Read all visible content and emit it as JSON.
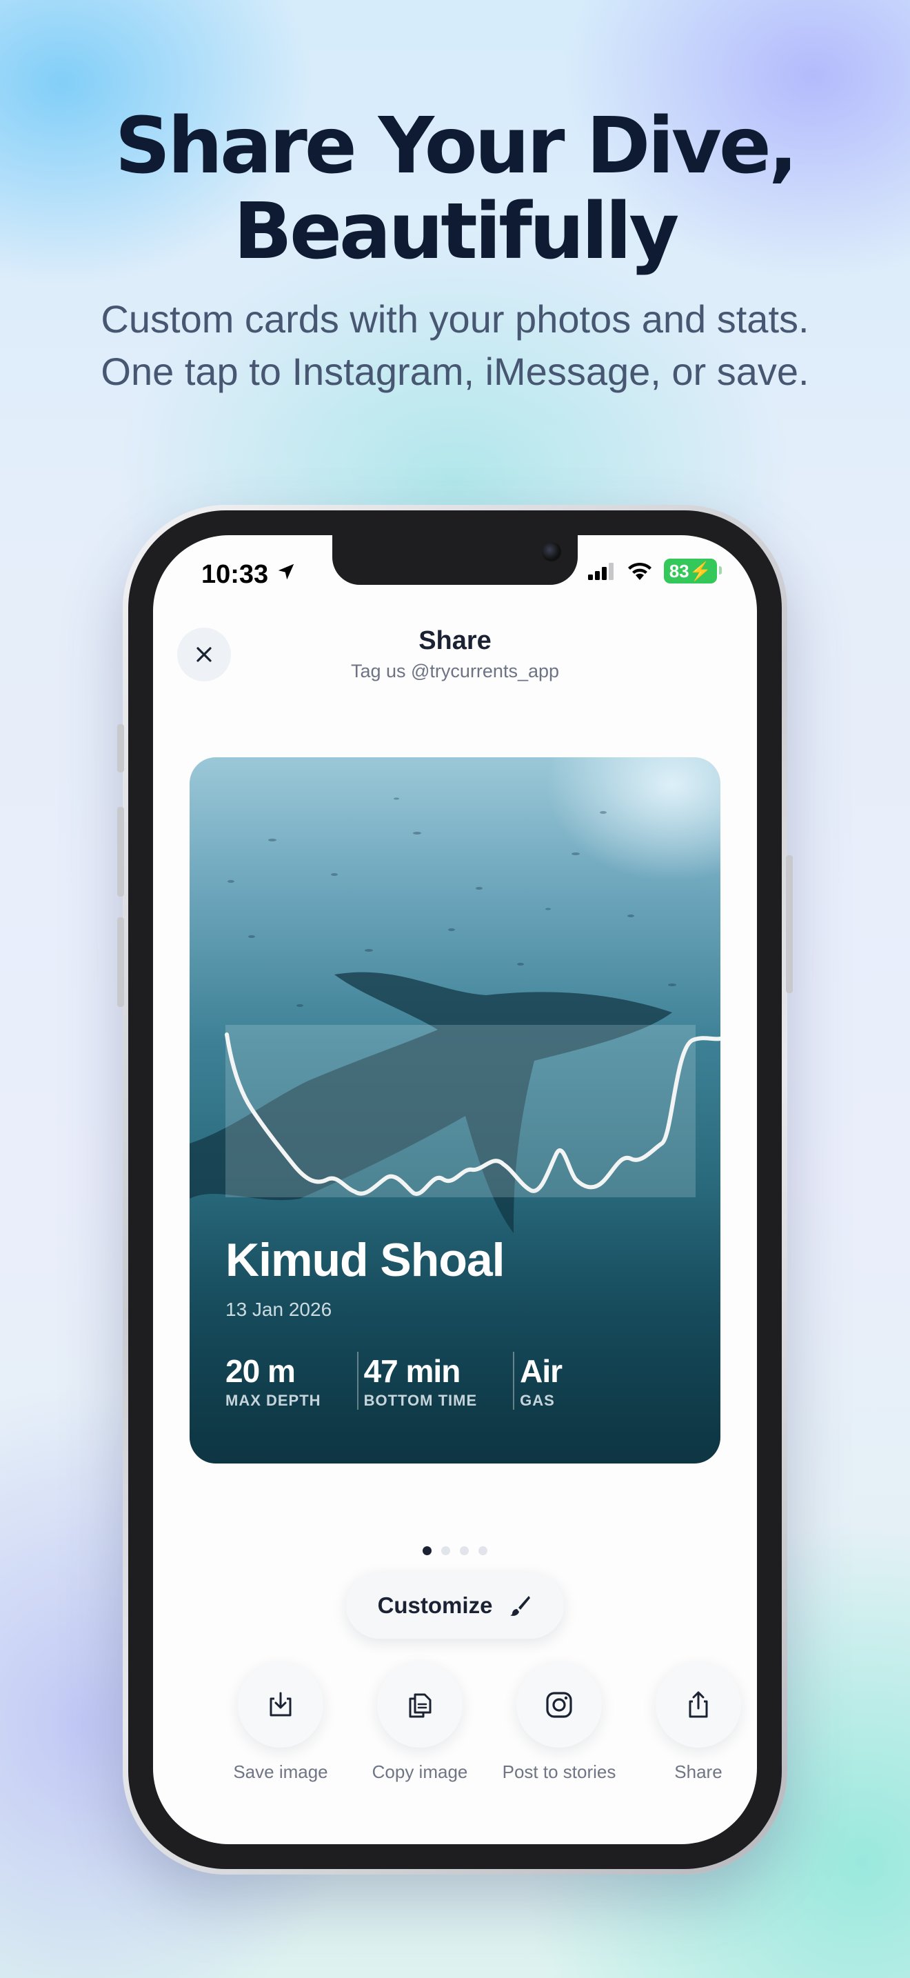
{
  "hero": {
    "title_line1": "Share Your Dive,",
    "title_line2": "Beautifully",
    "subtitle_line1": "Custom cards with your photos and stats.",
    "subtitle_line2": "One tap to Instagram, iMessage, or save."
  },
  "status_bar": {
    "time": "10:33",
    "battery": "83"
  },
  "header": {
    "title": "Share",
    "subtitle": "Tag us @trycurrents_app"
  },
  "card": {
    "dive_site": "Kimud Shoal",
    "date": "13 Jan 2026",
    "stats": [
      {
        "value": "20 m",
        "label": "MAX DEPTH"
      },
      {
        "value": "47 min",
        "label": "BOTTOM TIME"
      },
      {
        "value": "Air",
        "label": "GAS"
      }
    ]
  },
  "pager": {
    "count": 4,
    "active": 0
  },
  "customize_label": "Customize",
  "actions": [
    {
      "label": "Save image",
      "icon": "save-image-icon"
    },
    {
      "label": "Copy image",
      "icon": "copy-image-icon"
    },
    {
      "label": "Post to stories",
      "icon": "instagram-icon"
    },
    {
      "label": "Share",
      "icon": "share-icon"
    }
  ],
  "colors": {
    "heading": "#0f1b33",
    "accent_battery": "#34c759",
    "card_water_top": "#9bc8d8",
    "card_water_bottom": "#123f4d"
  }
}
